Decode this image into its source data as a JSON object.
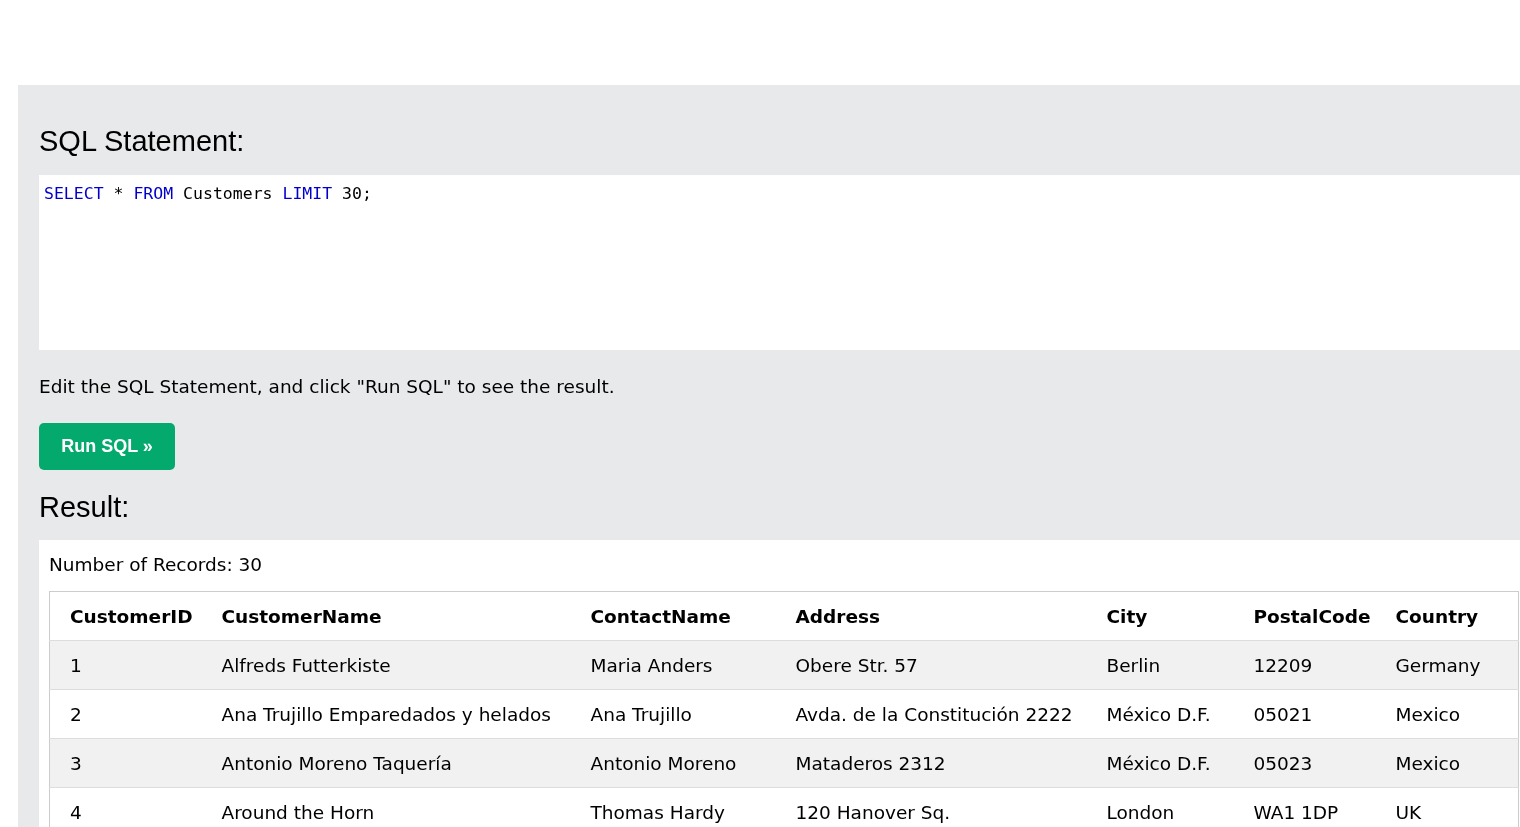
{
  "sql_panel": {
    "heading": "SQL Statement:",
    "editor": {
      "tokens": [
        {
          "text": "SELECT",
          "kind": "keyword"
        },
        {
          "text": "*",
          "kind": "plain"
        },
        {
          "text": "FROM",
          "kind": "keyword"
        },
        {
          "text": "Customers",
          "kind": "plain"
        },
        {
          "text": "LIMIT",
          "kind": "keyword"
        },
        {
          "text": "30;",
          "kind": "plain"
        }
      ]
    },
    "instructions": "Edit the SQL Statement, and click \"Run SQL\" to see the result.",
    "run_button": "Run SQL »"
  },
  "result": {
    "heading": "Result:",
    "record_count": "Number of Records: 30",
    "table": {
      "columns": [
        "CustomerID",
        "CustomerName",
        "ContactName",
        "Address",
        "City",
        "PostalCode",
        "Country"
      ],
      "rows": [
        [
          "1",
          "Alfreds Futterkiste",
          "Maria Anders",
          "Obere Str. 57",
          "Berlin",
          "12209",
          "Germany"
        ],
        [
          "2",
          "Ana Trujillo Emparedados y helados",
          "Ana Trujillo",
          "Avda. de la Constitución 2222",
          "México D.F.",
          "05021",
          "Mexico"
        ],
        [
          "3",
          "Antonio Moreno Taquería",
          "Antonio Moreno",
          "Mataderos 2312",
          "México D.F.",
          "05023",
          "Mexico"
        ],
        [
          "4",
          "Around the Horn",
          "Thomas Hardy",
          "120 Hanover Sq.",
          "London",
          "WA1 1DP",
          "UK"
        ]
      ]
    }
  }
}
